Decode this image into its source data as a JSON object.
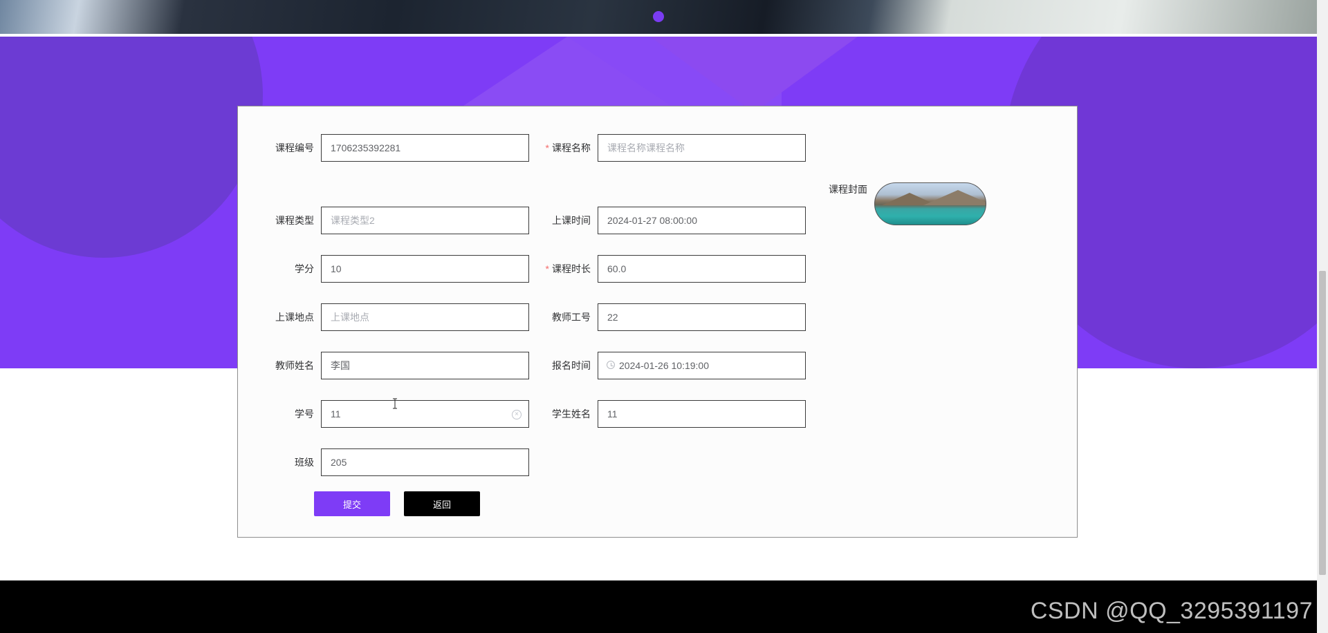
{
  "banner": {
    "indicator": "active-slide"
  },
  "form": {
    "course_id": {
      "label": "课程编号",
      "value": "1706235392281",
      "required": false
    },
    "course_name": {
      "label": "课程名称",
      "placeholder": "课程名称课程名称",
      "required": true
    },
    "course_type": {
      "label": "课程类型",
      "placeholder": "课程类型2",
      "required": false
    },
    "class_time": {
      "label": "上课时间",
      "value": "2024-01-27 08:00:00",
      "required": false
    },
    "credits": {
      "label": "学分",
      "value": "10",
      "required": false
    },
    "duration": {
      "label": "课程时长",
      "value": "60.0",
      "required": true
    },
    "location": {
      "label": "上课地点",
      "placeholder": "上课地点",
      "required": false
    },
    "teacher_id": {
      "label": "教师工号",
      "value": "22",
      "required": false
    },
    "teacher_name": {
      "label": "教师姓名",
      "value": "李国",
      "required": false
    },
    "signup_time": {
      "label": "报名时间",
      "value": "2024-01-26 10:19:00",
      "required": false
    },
    "student_id": {
      "label": "学号",
      "value": "11",
      "required": false
    },
    "student_name": {
      "label": "学生姓名",
      "value": "11",
      "required": false
    },
    "class_no": {
      "label": "班级",
      "value": "205",
      "required": false
    },
    "cover": {
      "label": "课程封面"
    },
    "required_mark": "*",
    "submit_label": "提交",
    "back_label": "返回"
  },
  "footer": {
    "watermark": "CSDN @QQ_3295391197"
  },
  "colors": {
    "accent": "#7e3cf6",
    "hero": "#7e3cf6",
    "footer": "#000000",
    "required": "#f56c6c"
  }
}
